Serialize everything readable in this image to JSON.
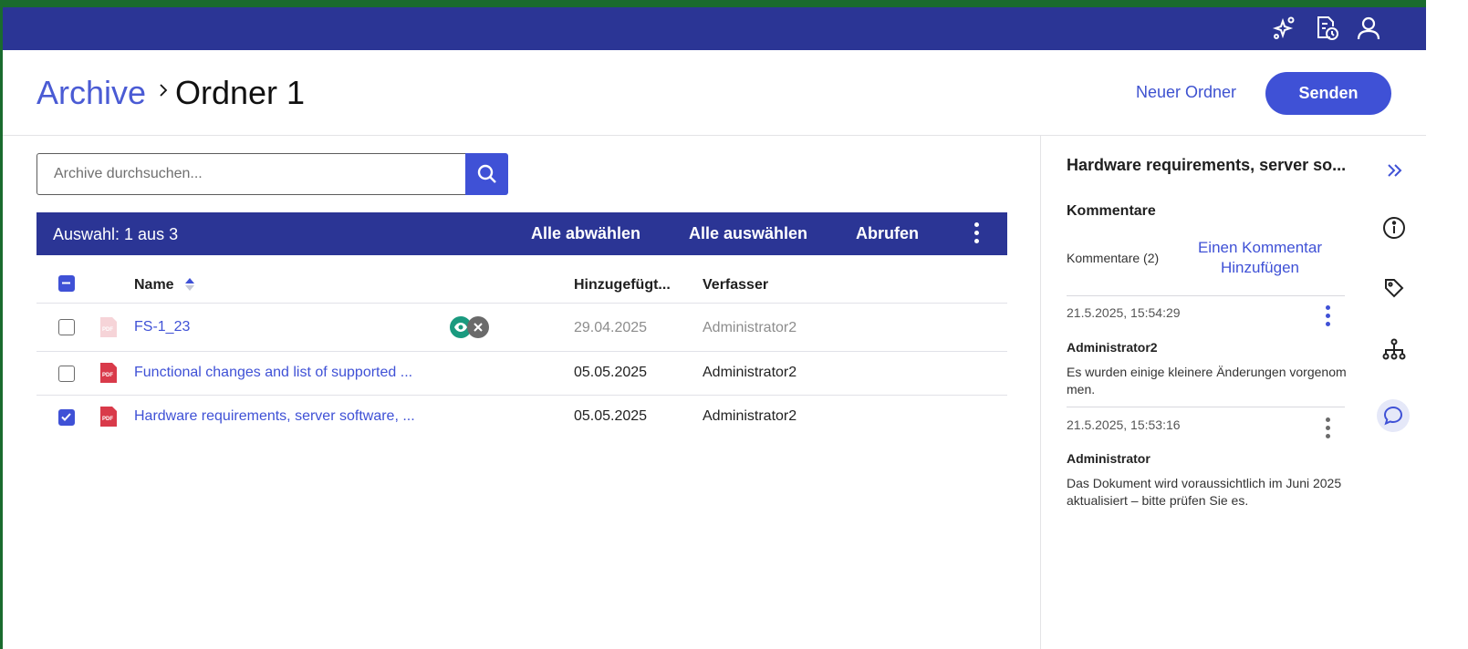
{
  "breadcrumb": {
    "root": "Archive",
    "current": "Ordner 1"
  },
  "header": {
    "new_folder": "Neuer Ordner",
    "send": "Senden"
  },
  "search": {
    "placeholder": "Archive durchsuchen..."
  },
  "selection": {
    "count": "Auswahl: 1 aus 3",
    "deselect_all": "Alle abwählen",
    "select_all": "Alle auswählen",
    "retrieve": "Abrufen"
  },
  "table": {
    "headers": {
      "name": "Name",
      "added": "Hinzugefügt...",
      "author": "Verfasser"
    },
    "rows": [
      {
        "name": "FS-1_23",
        "date": "29.04.2025",
        "author": "Administrator2",
        "checked": false
      },
      {
        "name": "Functional changes and list of supported ...",
        "date": "05.05.2025",
        "author": "Administrator2",
        "checked": false
      },
      {
        "name": "Hardware requirements, server software, ...",
        "date": "05.05.2025",
        "author": "Administrator2",
        "checked": true
      }
    ]
  },
  "panel": {
    "title": "Hardware requirements, server so...",
    "section": "Kommentare",
    "count_label": "Kommentare (2)",
    "add_comment": "Einen Kommentar Hinzufügen",
    "comments": [
      {
        "timestamp": "21.5.2025, 15:54:29",
        "author": "Administrator2",
        "text": "Es wurden einige kleinere Änderungen vorgenom men."
      },
      {
        "timestamp": "21.5.2025, 15:53:16",
        "author": "Administrator",
        "text": "Das Dokument wird voraussichtlich im Juni 2025 aktualisiert – bitte prüfen Sie es."
      }
    ]
  },
  "icons": {
    "topbar": [
      "sparkle-icon",
      "document-clock-icon",
      "user-icon"
    ],
    "side": [
      "double-chevron-right-icon",
      "info-icon",
      "tag-icon",
      "hierarchy-icon",
      "comment-icon"
    ],
    "row": [
      "pdf-icon",
      "eye-icon",
      "close-icon"
    ]
  },
  "colors": {
    "primary": "#3f51d6",
    "bar": "#2b3595",
    "teal": "#1a9a7f",
    "pdf_red": "#d93a4a"
  }
}
